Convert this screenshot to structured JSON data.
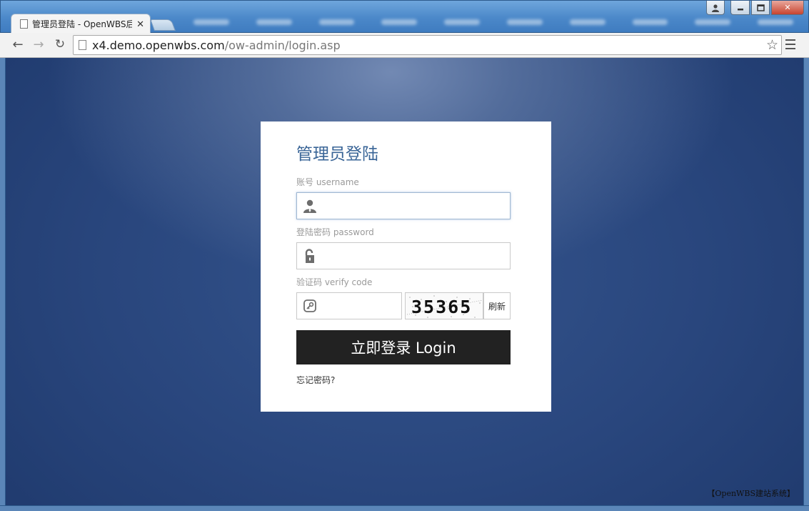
{
  "browser": {
    "tab_title": "管理员登陆 - OpenWBS后",
    "url_host": "x4.demo.openwbs.com",
    "url_path": "/ow-admin/login.asp",
    "window_controls": {
      "profile": "profile-icon",
      "minimize": "minimize-icon",
      "maximize": "maximize-icon",
      "close": "close-icon"
    }
  },
  "login": {
    "title": "管理员登陆",
    "username_label": "账号 username",
    "username_value": "",
    "password_label": "登陆密码 password",
    "password_value": "",
    "verify_label": "验证码 verify code",
    "verify_value": "",
    "captcha_text": "35365",
    "refresh_label": "刷新",
    "submit_label": "立即登录 Login",
    "forgot_label": "忘记密码?"
  },
  "footer": {
    "brand": "【OpenWBS建站系统】"
  },
  "colors": {
    "title": "#3a6597",
    "button_bg": "#222222",
    "background": "#2b4a82",
    "label": "#9a9a9a"
  }
}
